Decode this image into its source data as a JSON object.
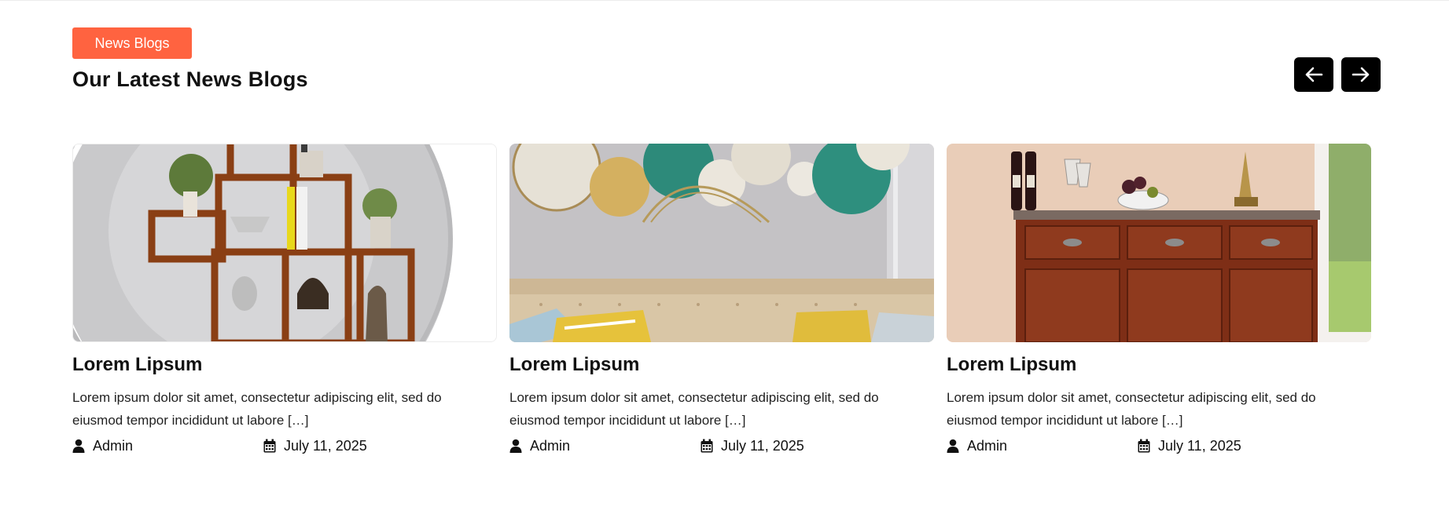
{
  "section": {
    "badge": "News Blogs",
    "title": "Our Latest News Blogs"
  },
  "nav": {
    "prev_icon": "arrow-left-icon",
    "next_icon": "arrow-right-icon"
  },
  "colors": {
    "accent": "#ff6340",
    "nav_button": "#000000"
  },
  "posts": [
    {
      "image": "wooden-wall-shelf-decor",
      "title": "Lorem Lipsum",
      "excerpt": "Lorem ipsum dolor sit amet, consectetur adipiscing elit, sed do eiusmod tempor incididunt ut labore […]",
      "author": "Admin",
      "date": "July 11, 2025"
    },
    {
      "image": "sofa-with-wall-plates-decor",
      "title": "Lorem Lipsum",
      "excerpt": "Lorem ipsum dolor sit amet, consectetur adipiscing elit, sed do eiusmod tempor incididunt ut labore […]",
      "author": "Admin",
      "date": "July 11, 2025"
    },
    {
      "image": "wooden-sideboard-cabinet",
      "title": "Lorem Lipsum",
      "excerpt": "Lorem ipsum dolor sit amet, consectetur adipiscing elit, sed do eiusmod tempor incididunt ut labore […]",
      "author": "Admin",
      "date": "July 11, 2025"
    }
  ]
}
